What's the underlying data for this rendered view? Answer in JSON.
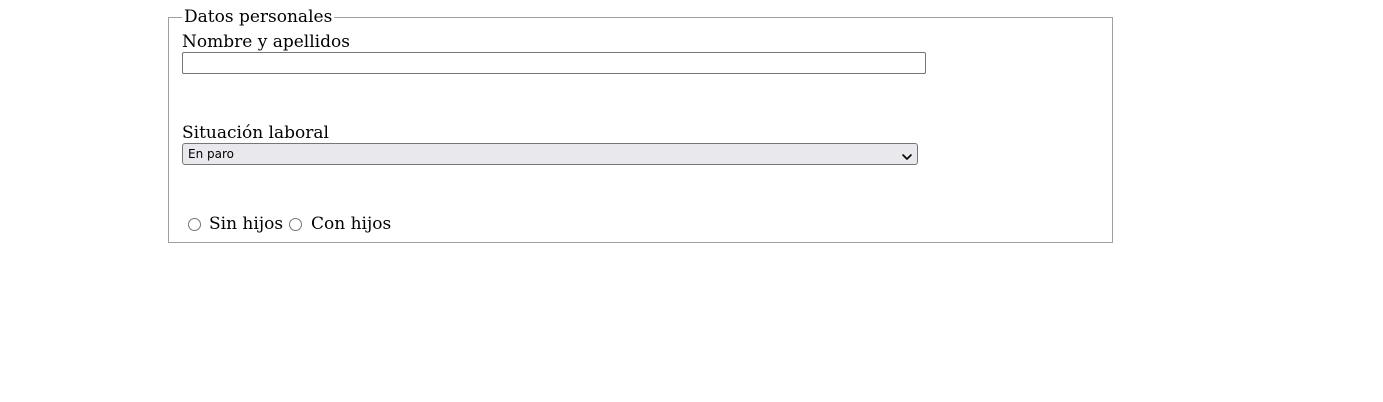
{
  "form": {
    "legend": "Datos personales",
    "name_field": {
      "label": "Nombre y apellidos",
      "value": "",
      "placeholder": ""
    },
    "work_field": {
      "label": "Situación laboral",
      "selected": "En paro"
    },
    "children": {
      "options": [
        {
          "label": "Sin hijos",
          "checked": false
        },
        {
          "label": "Con hijos",
          "checked": false
        }
      ]
    }
  },
  "icons": {
    "select_arrow": "chevron-down-icon"
  },
  "colors": {
    "border": "#a0a0a0",
    "control_border": "#767676",
    "select_bg": "#e9e9ed"
  }
}
